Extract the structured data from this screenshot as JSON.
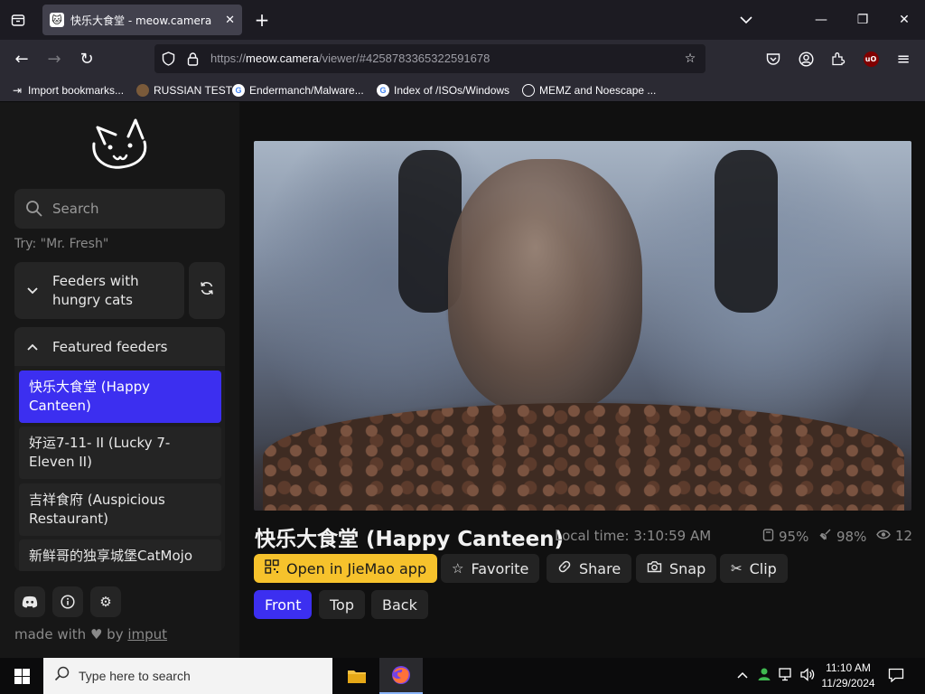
{
  "browser": {
    "tab_title": "快乐大食堂 - meow.camera",
    "url_prefix": "https://",
    "url_host": "meow.camera",
    "url_path": "/viewer/#4258783365322591678",
    "bookmarks": [
      {
        "label": "Import bookmarks..."
      },
      {
        "label": "RUSSIAN TEST"
      },
      {
        "label": "Endermanch/Malware..."
      },
      {
        "label": "Index of /ISOs/Windows"
      },
      {
        "label": "MEMZ and Noescape ..."
      }
    ]
  },
  "sidebar": {
    "search_placeholder": "Search",
    "try_hint": "Try: \"Mr. Fresh\"",
    "group_hungry_label": "Feeders with hungry cats",
    "group_featured_label": "Featured feeders",
    "feeders": [
      {
        "label": "快乐大食堂 (Happy Canteen)",
        "active": true
      },
      {
        "label": "好运7-11- II (Lucky 7-Eleven II)",
        "active": false
      },
      {
        "label": "吉祥食府 (Auspicious Restaurant)",
        "active": false
      },
      {
        "label": "新鲜哥的独享城堡CatMojo",
        "active": false
      }
    ],
    "footer_made_with": "made with",
    "footer_by": "by",
    "footer_author": "imput"
  },
  "camera": {
    "title": "快乐大食堂 (Happy Canteen)",
    "local_time": "Local time: 3:10:59 AM",
    "stat_food": "95%",
    "stat_battery": "98%",
    "stat_viewers": "12"
  },
  "actions": {
    "open_app": "Open in JieMao app",
    "favorite": "Favorite",
    "share": "Share",
    "snap": "Snap",
    "clip": "Clip"
  },
  "views": {
    "front": "Front",
    "top": "Top",
    "back": "Back"
  },
  "taskbar": {
    "search_placeholder": "Type here to search",
    "time": "11:10 AM",
    "date": "11/29/2024"
  },
  "colors": {
    "accent": "#3c2ff0",
    "yellow": "#f6c22c"
  }
}
